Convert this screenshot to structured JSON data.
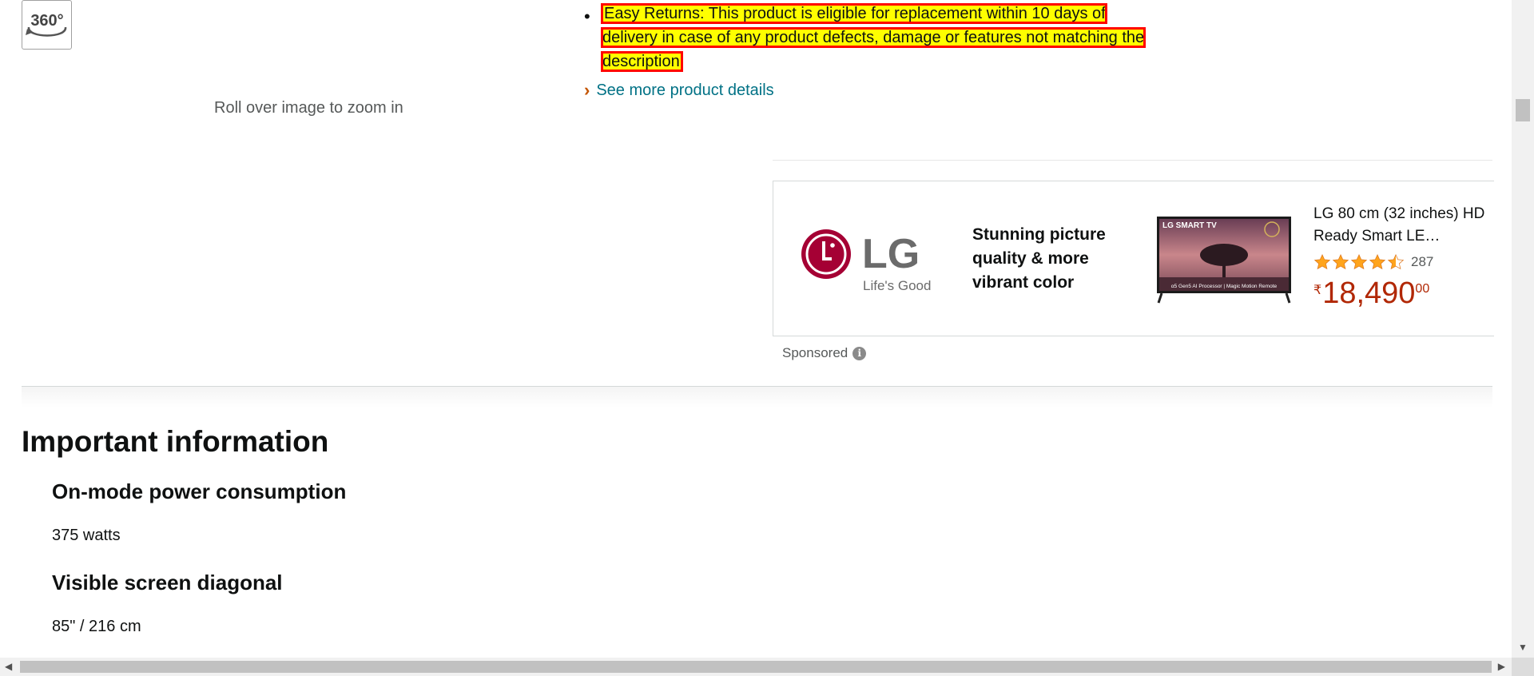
{
  "left_panel": {
    "view_360_label": "360°",
    "zoom_hint": "Roll over image to zoom in"
  },
  "feature_bullet": {
    "text": "Easy Returns: This product is eligible for replacement within 10 days of delivery in case of any product defects, damage or features not matching the description"
  },
  "see_more": {
    "chevron": "›",
    "label": "See more product details"
  },
  "sponsored_ad": {
    "brand": "LG",
    "brand_tagline": "Life's Good",
    "headline": "Stunning picture quality & more vibrant color",
    "tv_banner_text": "LG SMART TV",
    "tv_footer_text": "α5 Gen5 AI Processor | Magic Motion Remote",
    "product_title": "LG 80 cm (32 inches) HD Ready Smart LE…",
    "rating_stars": 4.5,
    "rating_count": "287",
    "price_symbol": "₹",
    "price_whole": "18,490",
    "price_fraction": "00",
    "sponsored_label": "Sponsored",
    "info_icon": "i"
  },
  "important_information": {
    "title": "Important information",
    "items": [
      {
        "label": "On-mode power consumption",
        "value": "375 watts"
      },
      {
        "label": "Visible screen diagonal",
        "value": "85\" / 216 cm"
      }
    ]
  },
  "colors": {
    "link": "#007185",
    "price": "#b12704",
    "highlight": "#ffff00",
    "highlight_border": "#ff0000",
    "star": "#ffa41c",
    "lg_red": "#a50034"
  }
}
